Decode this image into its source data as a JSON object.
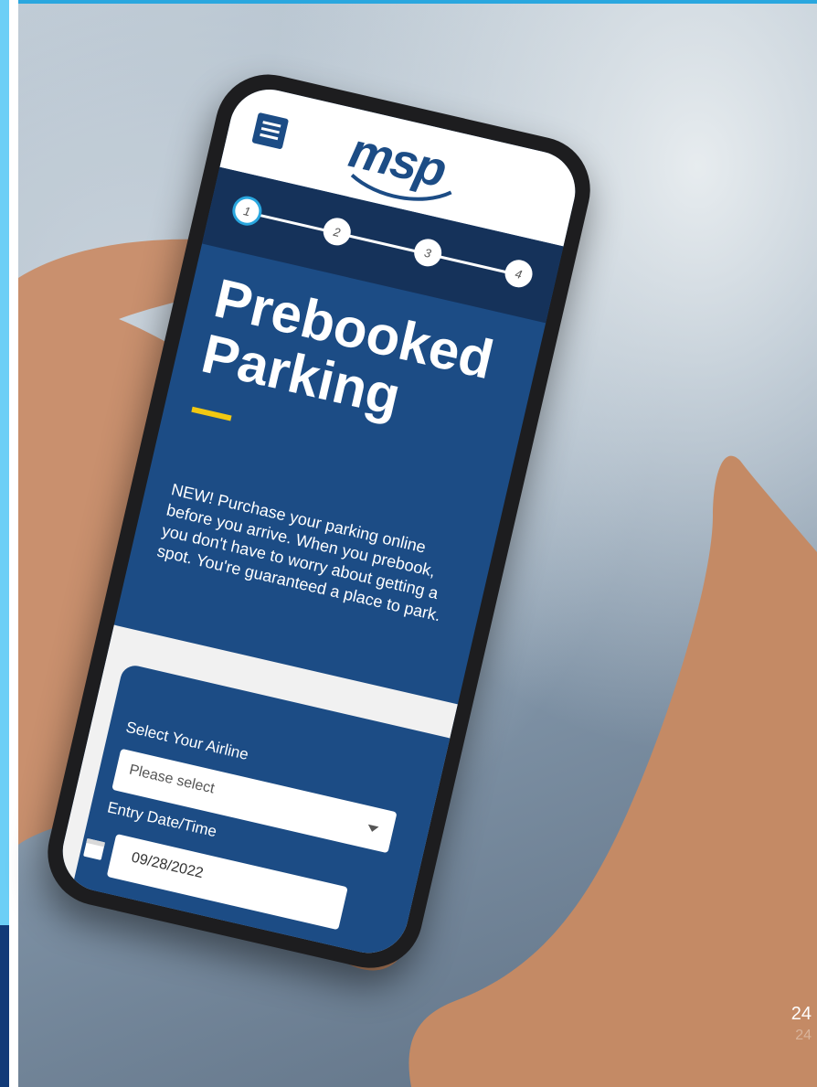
{
  "slide": {
    "page_number": "24",
    "page_number_ghost": "24"
  },
  "app": {
    "logo_text": "msp",
    "menu_icon": "hamburger-menu-icon",
    "steps": [
      "1",
      "2",
      "3",
      "4"
    ],
    "active_step": 1,
    "title_line1": "Prebooked",
    "title_line2": "Parking",
    "intro": "NEW! Purchase your parking online before you arrive. When you prebook, you don't have to worry about getting a spot. You're guaranteed a place to park.",
    "airline_label": "Select Your Airline",
    "airline_placeholder": "Please select",
    "entry_label": "Entry Date/Time",
    "entry_date": "09/28/2022",
    "calendar_icon": "calendar-icon"
  },
  "colors": {
    "brand_blue": "#1c4c85",
    "stepper_dark": "#15325a",
    "accent_yellow": "#f2c811",
    "active_step_ring": "#2aa7df",
    "slide_left_bar": "#6ccff6"
  }
}
